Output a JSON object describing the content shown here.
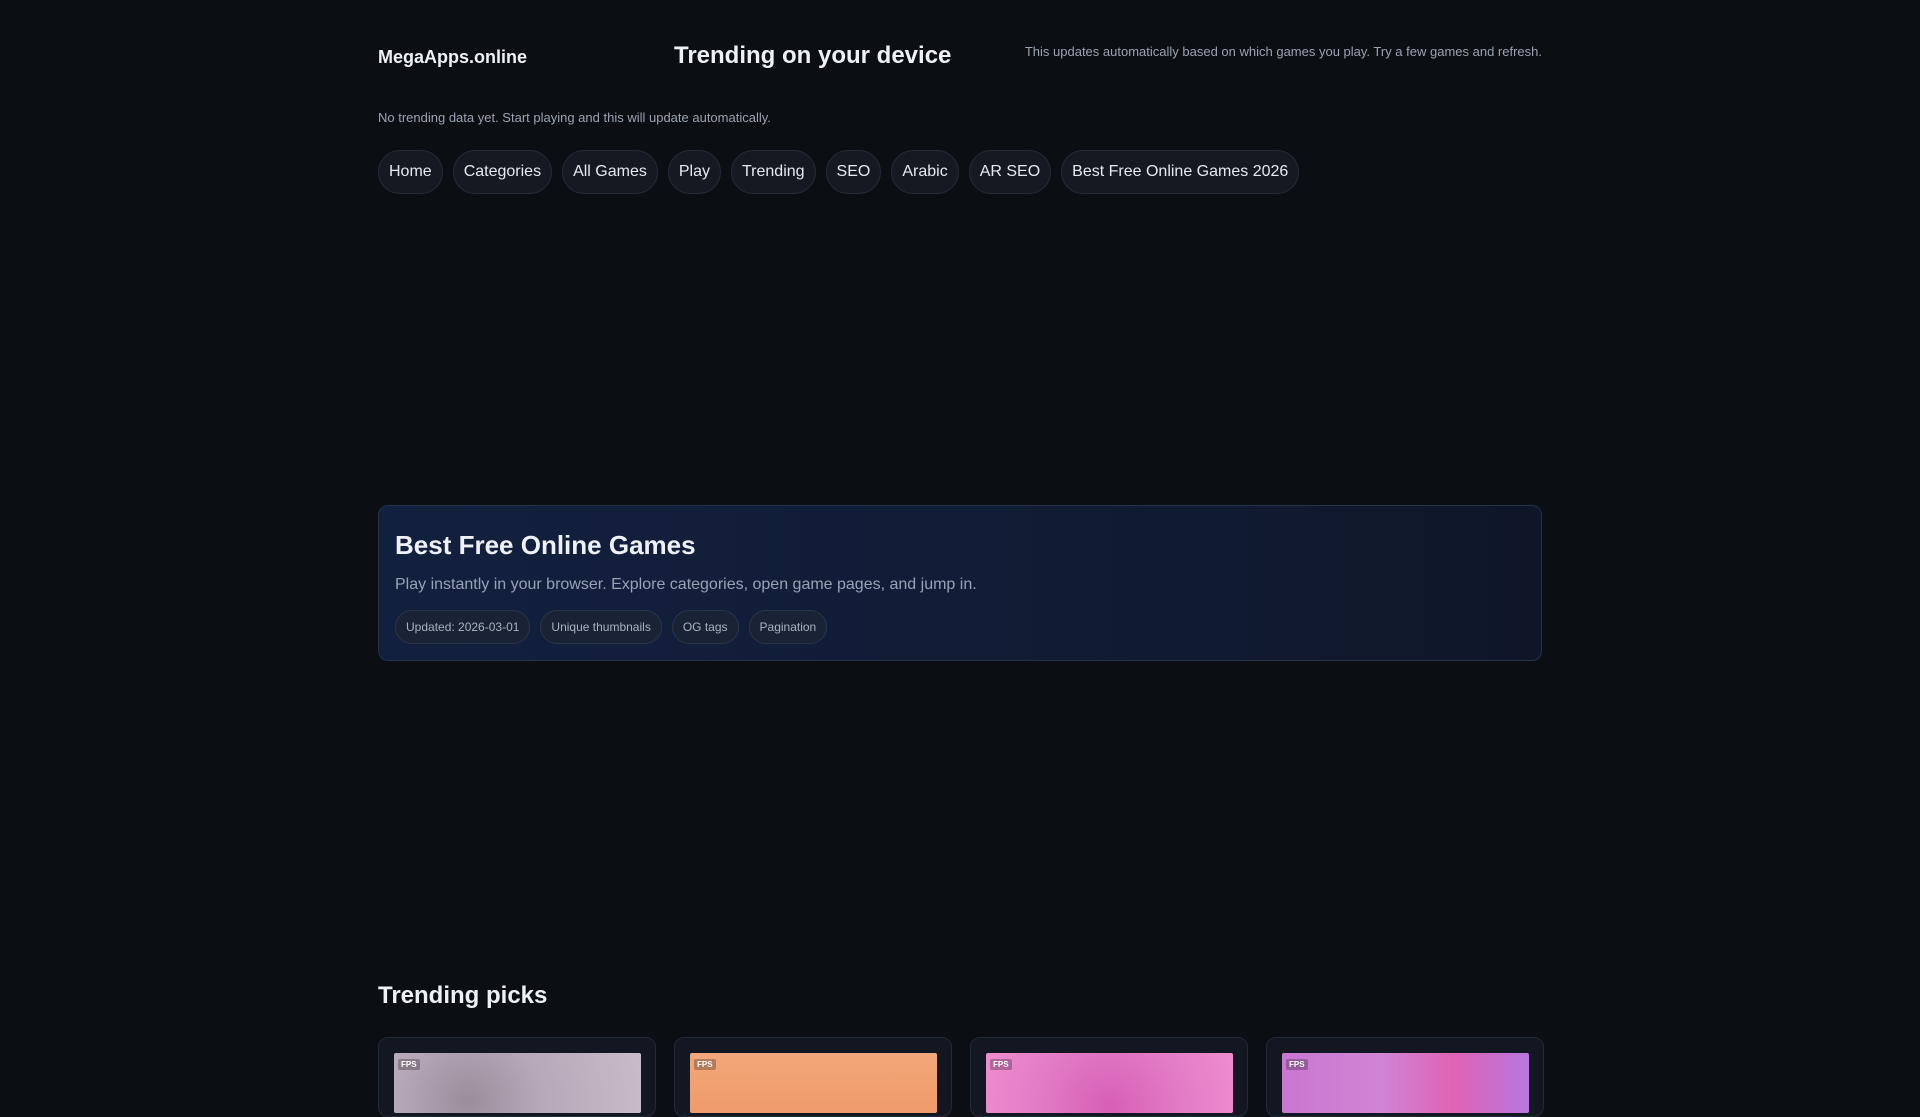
{
  "header": {
    "brand": "MegaApps.online",
    "title": "Trending on your device",
    "note": "This updates automatically based on which games you play. Try a few games and refresh."
  },
  "status": {
    "no_data": "No trending data yet. Start playing and this will update automatically."
  },
  "nav": {
    "items": [
      {
        "label": "Home"
      },
      {
        "label": "Categories"
      },
      {
        "label": "All Games"
      },
      {
        "label": "Play"
      },
      {
        "label": "Trending"
      },
      {
        "label": "SEO"
      },
      {
        "label": "Arabic"
      },
      {
        "label": "AR SEO"
      },
      {
        "label": "Best Free Online Games 2026"
      }
    ]
  },
  "hero": {
    "title": "Best Free Online Games",
    "subtitle": "Play instantly in your browser. Explore categories, open game pages, and jump in.",
    "tags": [
      {
        "label": "Updated: 2026-03-01"
      },
      {
        "label": "Unique thumbnails"
      },
      {
        "label": "OG tags"
      },
      {
        "label": "Pagination"
      }
    ]
  },
  "trending": {
    "title": "Trending picks",
    "cards": [
      {
        "badge": "FPS"
      },
      {
        "badge": "FPS"
      },
      {
        "badge": "FPS"
      },
      {
        "badge": "FPS"
      }
    ]
  }
}
